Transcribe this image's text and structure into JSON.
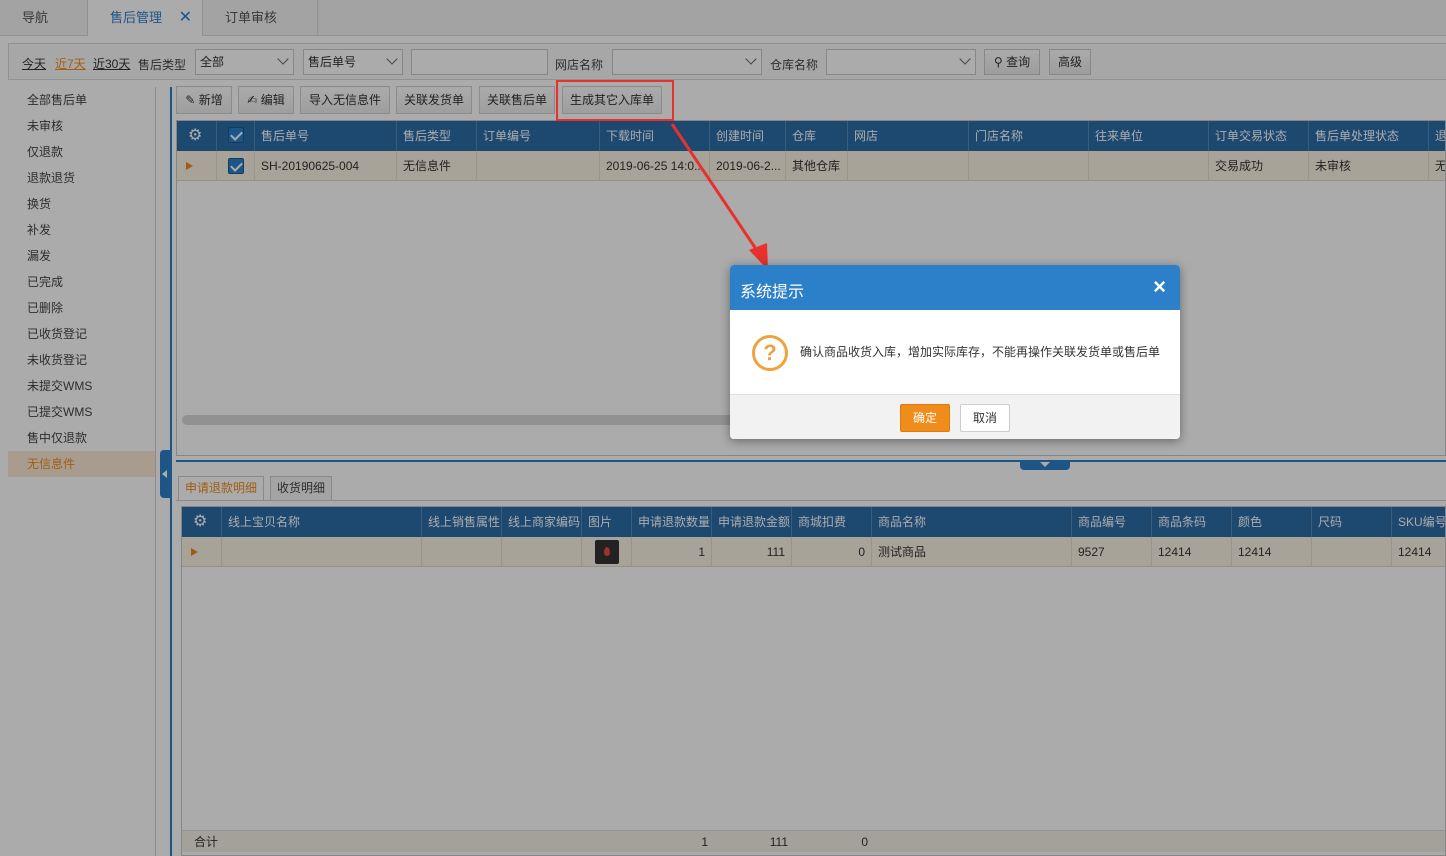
{
  "tabs": [
    {
      "label": "导航"
    },
    {
      "label": "售后管理",
      "close": "✕"
    },
    {
      "label": "订单审核"
    }
  ],
  "filter": {
    "today": "今天",
    "last7": "近7天",
    "last30": "近30天",
    "type_label": "售后类型",
    "type_value": "全部",
    "field_select": "售后单号",
    "field_value": "",
    "shop_label": "网店名称",
    "shop_value": "",
    "warehouse_label": "仓库名称",
    "warehouse_value": "",
    "search_btn": "查询",
    "advanced_btn": "高级"
  },
  "sidebar": {
    "items": [
      {
        "label": "全部售后单"
      },
      {
        "label": "未审核"
      },
      {
        "label": "仅退款"
      },
      {
        "label": "退款退货"
      },
      {
        "label": "换货"
      },
      {
        "label": "补发"
      },
      {
        "label": "漏发"
      },
      {
        "label": "已完成"
      },
      {
        "label": "已删除"
      },
      {
        "label": "已收货登记"
      },
      {
        "label": "未收货登记"
      },
      {
        "label": "未提交WMS"
      },
      {
        "label": "已提交WMS"
      },
      {
        "label": "售中仅退款"
      },
      {
        "label": "无信息件"
      }
    ]
  },
  "toolbar": {
    "add": "新增",
    "edit": "编辑",
    "import": "导入无信息件",
    "link_ship": "关联发货单",
    "link_after": "关联售后单",
    "gen_in": "生成其它入库单"
  },
  "main_grid": {
    "headers": [
      "售后单号",
      "售后类型",
      "订单编号",
      "下载时间",
      "创建时间",
      "仓库",
      "网店",
      "门店名称",
      "往来单位",
      "订单交易状态",
      "售后单处理状态",
      "退"
    ],
    "row": [
      "SH-20190625-004",
      "无信息件",
      "",
      "2019-06-25 14:0...",
      "2019-06-2...",
      "其他仓库",
      "",
      "",
      "",
      "交易成功",
      "未审核",
      "无"
    ]
  },
  "detail_tabs": {
    "refund": "申请退款明细",
    "receive": "收货明细"
  },
  "detail_grid": {
    "headers": [
      "线上宝贝名称",
      "线上销售属性",
      "线上商家编码",
      "图片",
      "申请退款数量",
      "申请退款金额",
      "商城扣费",
      "商品名称",
      "商品编号",
      "商品条码",
      "颜色",
      "尺码",
      "SKU编号"
    ],
    "row": [
      "",
      "",
      "",
      "",
      "1",
      "111",
      "0",
      "测试商品",
      "9527",
      "12414",
      "12414",
      "",
      "12414"
    ],
    "total_label": "合计",
    "total_qty": "1",
    "total_amount": "111",
    "total_fee": "0"
  },
  "dialog": {
    "title": "系统提示",
    "message": "确认商品收货入库，增加实际库存，不能再操作关联发货单或售后单",
    "ok": "确定",
    "cancel": "取消",
    "close": "×",
    "icon": "?"
  },
  "colors": {
    "accent": "#2c7fc9",
    "orange": "#f08c1b",
    "annotation": "#e8312d"
  }
}
